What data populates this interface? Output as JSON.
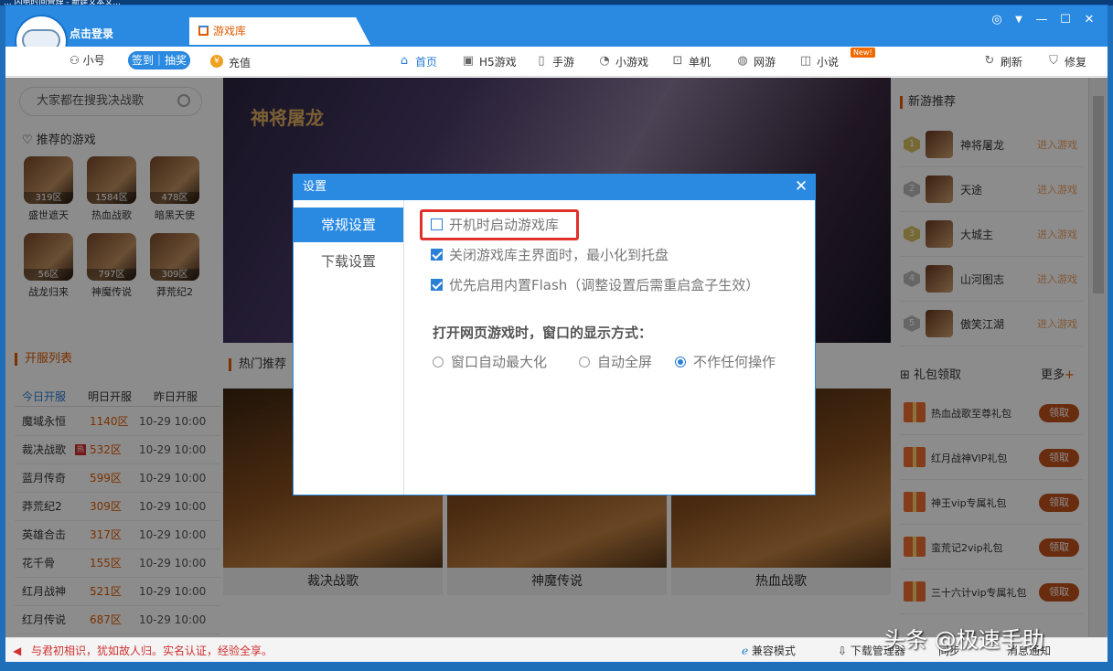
{
  "desktop_strip": "...  闪电时间管理 - 新建文本文...",
  "app": {
    "login_link": "点击登录",
    "small_account": "小号",
    "signin": "签到｜抽奖",
    "recharge": "充值",
    "coin_glyph": "¥",
    "tab_label": "游戏库",
    "nav": [
      {
        "label": "首页",
        "icon": "home-icon",
        "glyph": "⌂"
      },
      {
        "label": "H5游戏",
        "icon": "h5-icon",
        "glyph": "▣"
      },
      {
        "label": "手游",
        "icon": "phone-icon",
        "glyph": "▯"
      },
      {
        "label": "小游戏",
        "icon": "pacman-icon",
        "glyph": "◔"
      },
      {
        "label": "单机",
        "icon": "gamepad-icon",
        "glyph": "⊡"
      },
      {
        "label": "网游",
        "icon": "globe-icon",
        "glyph": "◍"
      },
      {
        "label": "小说",
        "icon": "book-icon",
        "glyph": "◫"
      }
    ],
    "new_badge": "New!",
    "refresh": "刷新",
    "repair": "修复",
    "accent_color": "#2a8ae2"
  },
  "left": {
    "search_placeholder": "大家都在搜我决战歌",
    "recommend_title": "推荐的游戏",
    "recommend_games": [
      {
        "name": "盛世遮天",
        "server": "319区"
      },
      {
        "name": "热血战歌",
        "server": "1584区"
      },
      {
        "name": "暗黑天使",
        "server": "478区"
      },
      {
        "name": "战龙归来",
        "server": "56区"
      },
      {
        "name": "神魔传说",
        "server": "797区"
      },
      {
        "name": "莽荒纪2",
        "server": "309区"
      }
    ],
    "server_list_title": "开服列表",
    "server_tabs": [
      "今日开服",
      "明日开服",
      "昨日开服"
    ],
    "servers": [
      {
        "game": "魔域永恒",
        "zone": "1140区",
        "time": "10-29 10:00"
      },
      {
        "game": "裁决战歌",
        "zone": "532区",
        "time": "10-29 10:00",
        "badge": "热"
      },
      {
        "game": "蓝月传奇",
        "zone": "599区",
        "time": "10-29 10:00"
      },
      {
        "game": "莽荒纪2",
        "zone": "309区",
        "time": "10-29 10:00"
      },
      {
        "game": "英雄合击",
        "zone": "317区",
        "time": "10-29 10:00"
      },
      {
        "game": "花千骨",
        "zone": "155区",
        "time": "10-29 10:00"
      },
      {
        "game": "红月战神",
        "zone": "521区",
        "time": "10-29 10:00"
      },
      {
        "game": "红月传说",
        "zone": "687区",
        "time": "10-29 10:00"
      }
    ]
  },
  "center": {
    "banner_title": "神将屠龙",
    "hot_title": "热门推荐",
    "cards": [
      "裁决战歌",
      "神魔传说",
      "热血战歌"
    ]
  },
  "right": {
    "new_games_title": "新游推荐",
    "new_games": [
      {
        "rank": "1",
        "name": "神将屠龙",
        "action": "进入游戏"
      },
      {
        "rank": "2",
        "name": "天途",
        "action": "进入游戏"
      },
      {
        "rank": "3",
        "name": "大城主",
        "action": "进入游戏"
      },
      {
        "rank": "4",
        "name": "山河图志",
        "action": "进入游戏"
      },
      {
        "rank": "5",
        "name": "傲笑江湖",
        "action": "进入游戏"
      }
    ],
    "gift_title": "礼包领取",
    "gift_more": "更多",
    "gifts": [
      {
        "name": "热血战歌至尊礼包",
        "action": "领取"
      },
      {
        "name": "红月战神VIP礼包",
        "action": "领取"
      },
      {
        "name": "神王vip专属礼包",
        "action": "领取"
      },
      {
        "name": "蛮荒记2vip礼包",
        "action": "领取"
      },
      {
        "name": "三十六计vip专属礼包",
        "action": "领取"
      }
    ]
  },
  "statusbar": {
    "notice": "与君初相识，犹如故人归。实名认证，经验全享。",
    "compat": "兼容模式",
    "download": "下载管理器",
    "sync": "同步",
    "messages": "消息通知"
  },
  "dialog": {
    "title": "设置",
    "close": "✕",
    "tabs": [
      "常规设置",
      "下载设置"
    ],
    "options": [
      {
        "label": "开机时启动游戏库",
        "checked": false
      },
      {
        "label": "关闭游戏库主界面时，最小化到托盘",
        "checked": true
      },
      {
        "label": "优先启用内置Flash（调整设置后需重启盒子生效）",
        "checked": true
      }
    ],
    "section_title": "打开网页游戏时，窗口的显示方式：",
    "radios": [
      {
        "label": "窗口自动最大化",
        "selected": false
      },
      {
        "label": "自动全屏",
        "selected": false
      },
      {
        "label": "不作任何操作",
        "selected": true
      }
    ],
    "highlight_color": "#e0302a"
  },
  "watermark": "头条 @极速手助"
}
